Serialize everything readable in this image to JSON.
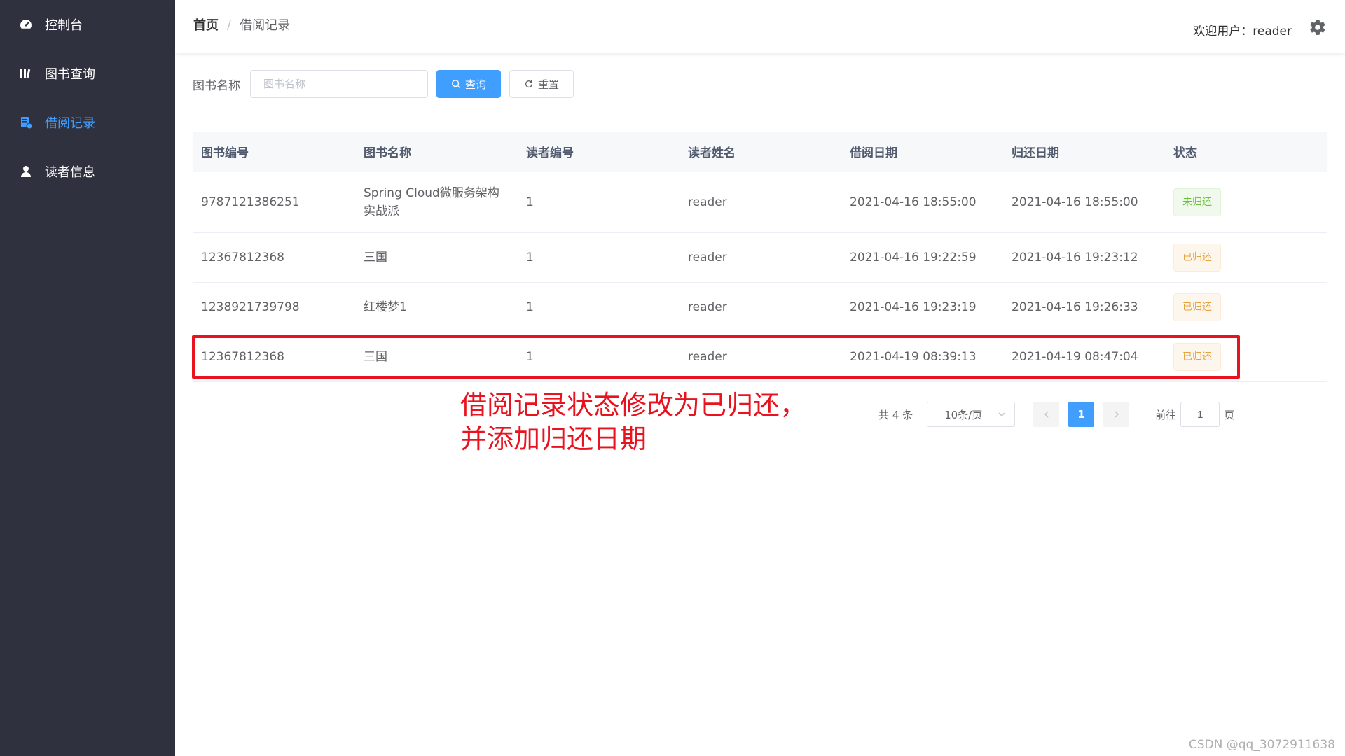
{
  "sidebar": {
    "items": [
      {
        "label": "控制台",
        "icon": "dashboard-icon",
        "active": false
      },
      {
        "label": "图书查询",
        "icon": "books-icon",
        "active": false
      },
      {
        "label": "借阅记录",
        "icon": "borrow-record-icon",
        "active": true
      },
      {
        "label": "读者信息",
        "icon": "user-icon",
        "active": false
      }
    ]
  },
  "header": {
    "breadcrumb_home": "首页",
    "breadcrumb_sep": "/",
    "breadcrumb_current": "借阅记录",
    "welcome": "欢迎用户：reader"
  },
  "search": {
    "label": "图书名称",
    "placeholder": "图书名称",
    "value": "",
    "query_label": "查询",
    "reset_label": "重置"
  },
  "table": {
    "columns": [
      "图书编号",
      "图书名称",
      "读者编号",
      "读者姓名",
      "借阅日期",
      "归还日期",
      "状态"
    ],
    "rows": [
      [
        "9787121386251",
        "Spring Cloud微服务架构实战派",
        "1",
        "reader",
        "2021-04-16 18:55:00",
        "2021-04-16 18:55:00",
        "未归还"
      ],
      [
        "12367812368",
        "三国",
        "1",
        "reader",
        "2021-04-16 19:22:59",
        "2021-04-16 19:23:12",
        "已归还"
      ],
      [
        "1238921739798",
        "红楼梦1",
        "1",
        "reader",
        "2021-04-16 19:23:19",
        "2021-04-16 19:26:33",
        "已归还"
      ],
      [
        "12367812368",
        "三国",
        "1",
        "reader",
        "2021-04-19 08:39:13",
        "2021-04-19 08:47:04",
        "已归还"
      ]
    ]
  },
  "annotation": {
    "line1": "借阅记录状态修改为已归还，",
    "line2": "并添加归还日期"
  },
  "pagination": {
    "total": "共 4 条",
    "page_size": "10条/页",
    "current_page": "1",
    "goto_prefix": "前往",
    "goto_value": "1",
    "goto_suffix": "页"
  },
  "watermark": "CSDN @qq_3072911638",
  "colors": {
    "sidebar_bg": "#2f323e",
    "accent": "#409eff",
    "annotation_red": "#e8131e",
    "tag_green": "#67c23a",
    "tag_orange": "#e6a23c"
  }
}
